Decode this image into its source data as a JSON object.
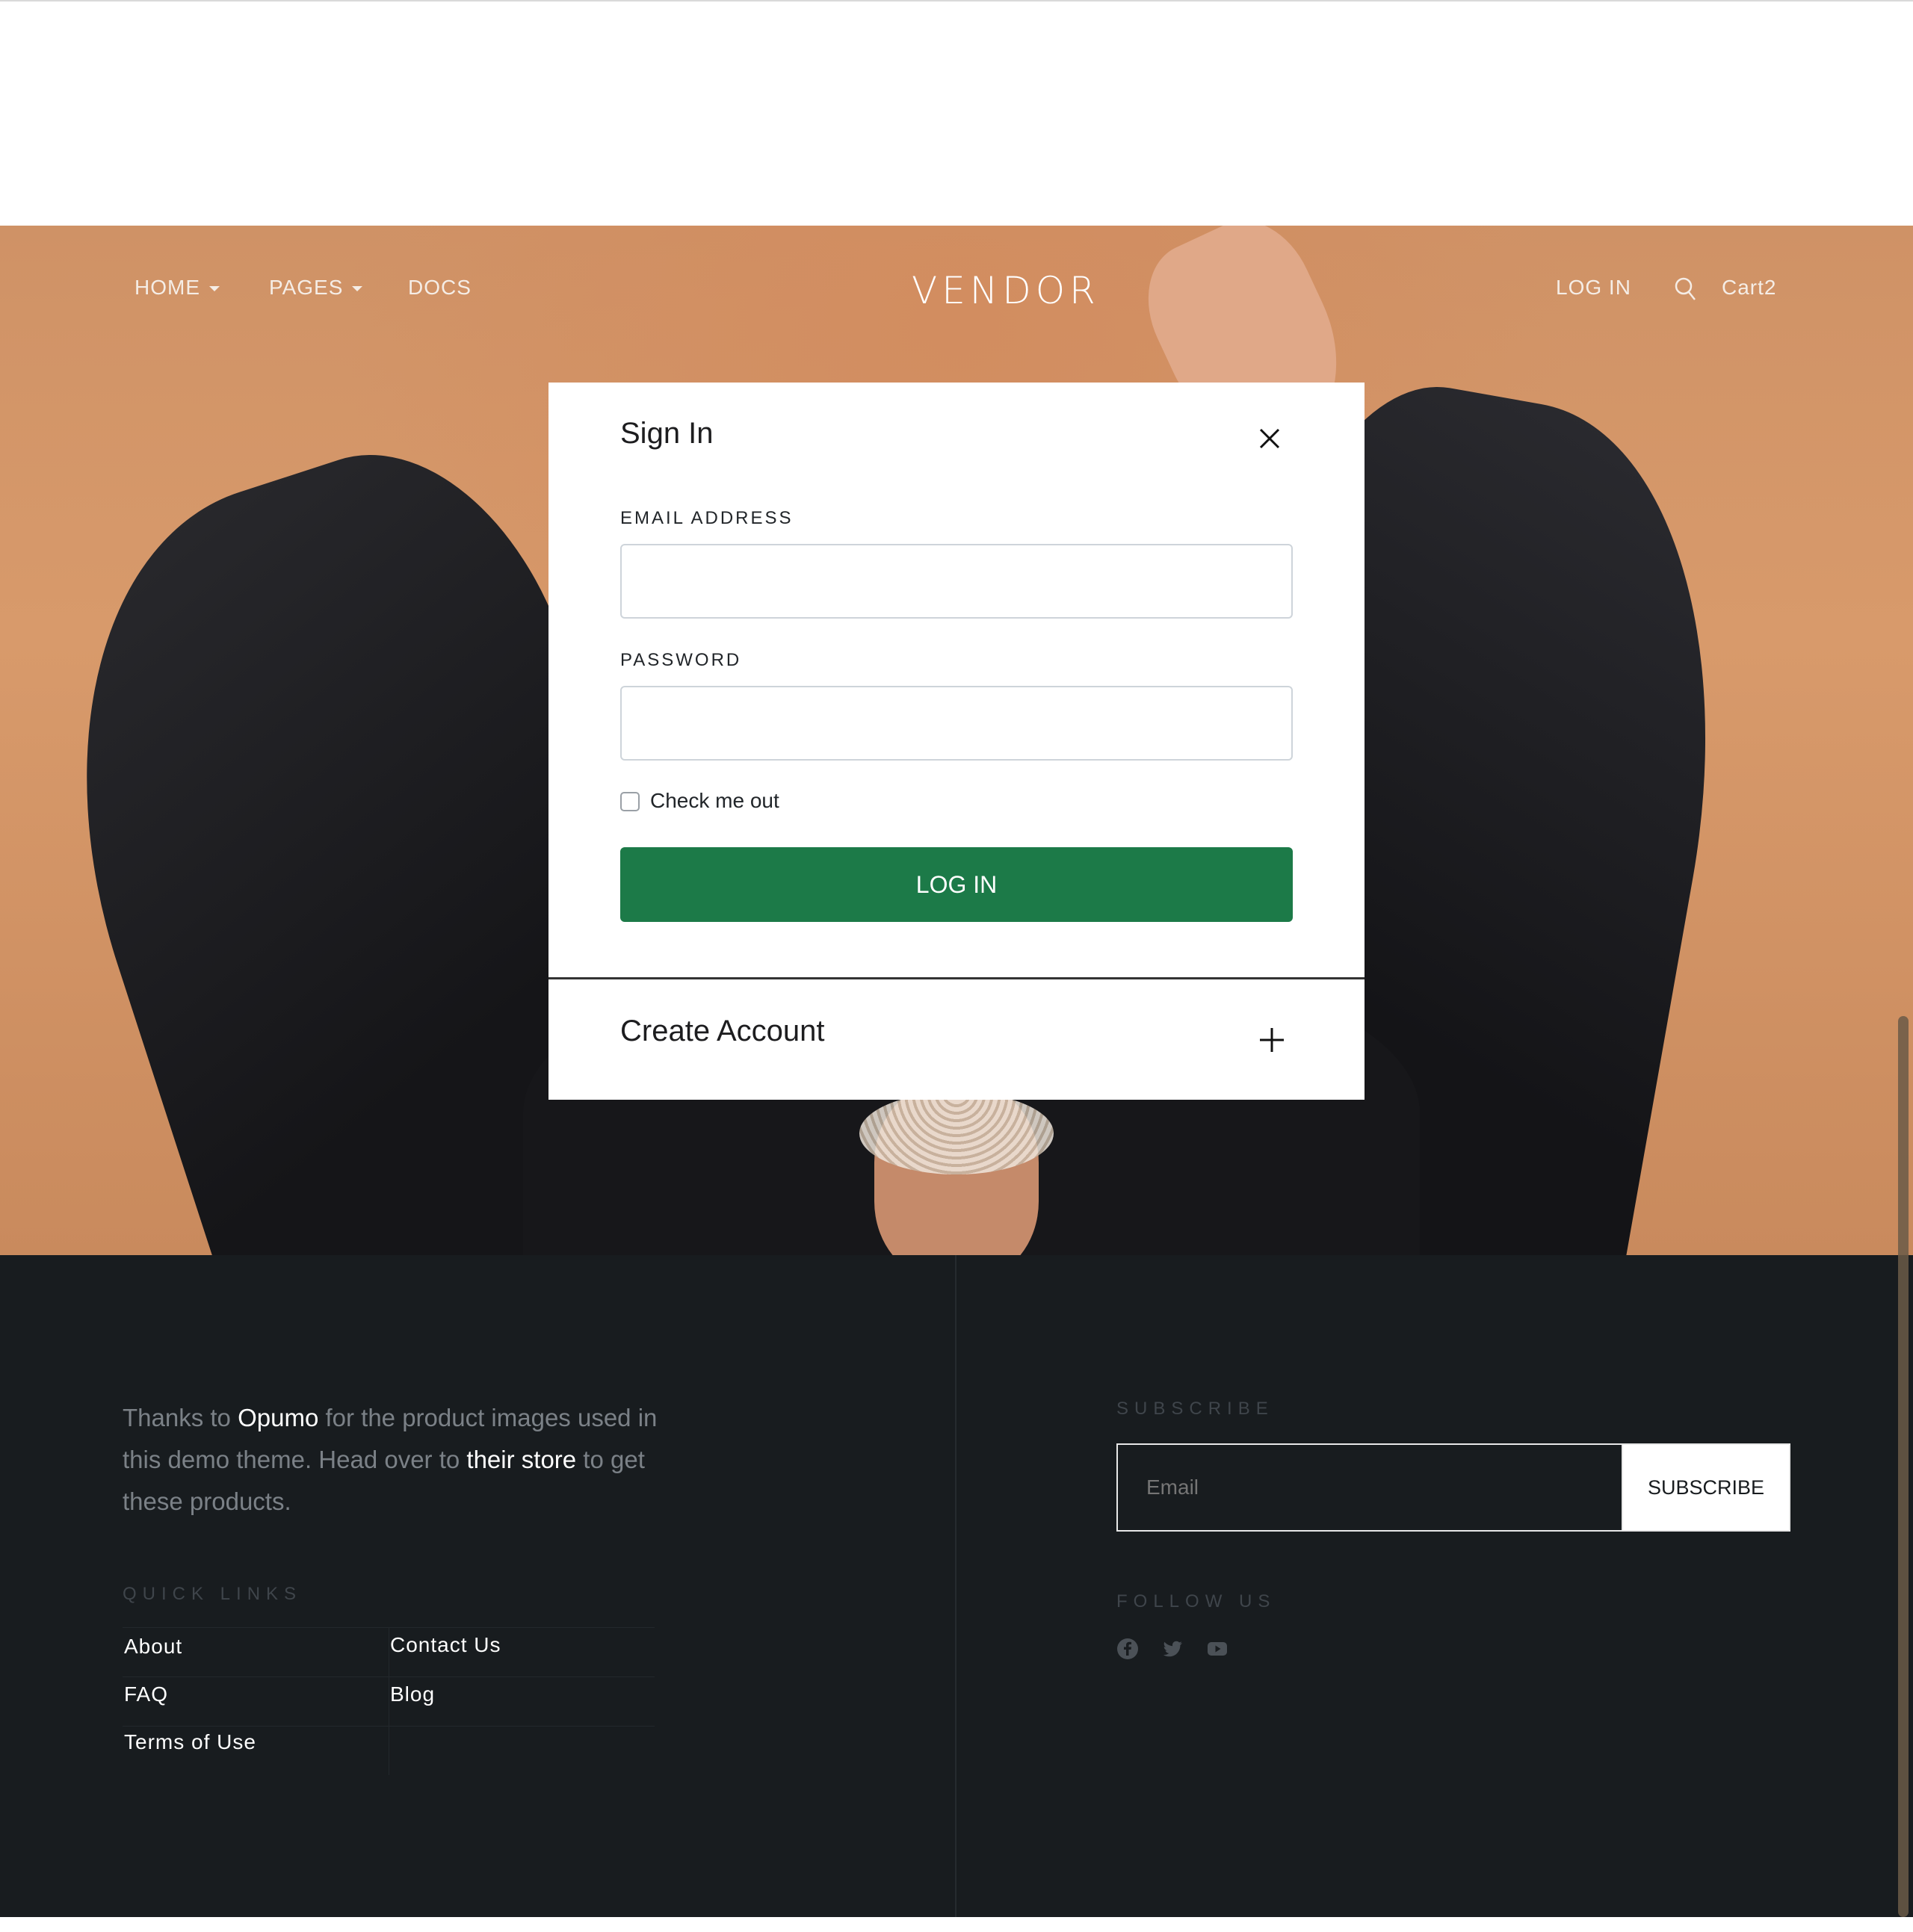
{
  "nav": {
    "home": "HOME",
    "pages": "PAGES",
    "docs": "DOCS",
    "logo": "VENDOR",
    "login": "LOG IN",
    "cart": "Cart2",
    "search_icon": "search-icon",
    "caret_icon": "caret-down-icon"
  },
  "modal": {
    "title": "Sign In",
    "close_icon": "close-icon",
    "email_label": "EMAIL ADDRESS",
    "email_value": "",
    "password_label": "PASSWORD",
    "password_value": "",
    "checkbox_label": "Check me out",
    "checkbox_checked": false,
    "login_button": "LOG IN",
    "create_account": "Create Account",
    "plus_icon": "plus-icon",
    "button_color": "#1c7a48"
  },
  "footer": {
    "credit": {
      "part1": "Thanks to ",
      "link1": "Opumo",
      "part2": " for the product images used in this demo theme. Head over to ",
      "link2": "their store",
      "part3": " to get these products."
    },
    "quick_links_heading": "QUICK LINKS",
    "quick_links": {
      "about": "About",
      "contact": "Contact Us",
      "faq": "FAQ",
      "blog": "Blog",
      "terms": "Terms of Use"
    },
    "subscribe_heading": "SUBSCRIBE",
    "subscribe_placeholder": "Email",
    "subscribe_button": "SUBSCRIBE",
    "follow_heading": "FOLLOW US",
    "social_icons": [
      "facebook-icon",
      "twitter-icon",
      "youtube-icon"
    ],
    "background": "#181c1f"
  }
}
